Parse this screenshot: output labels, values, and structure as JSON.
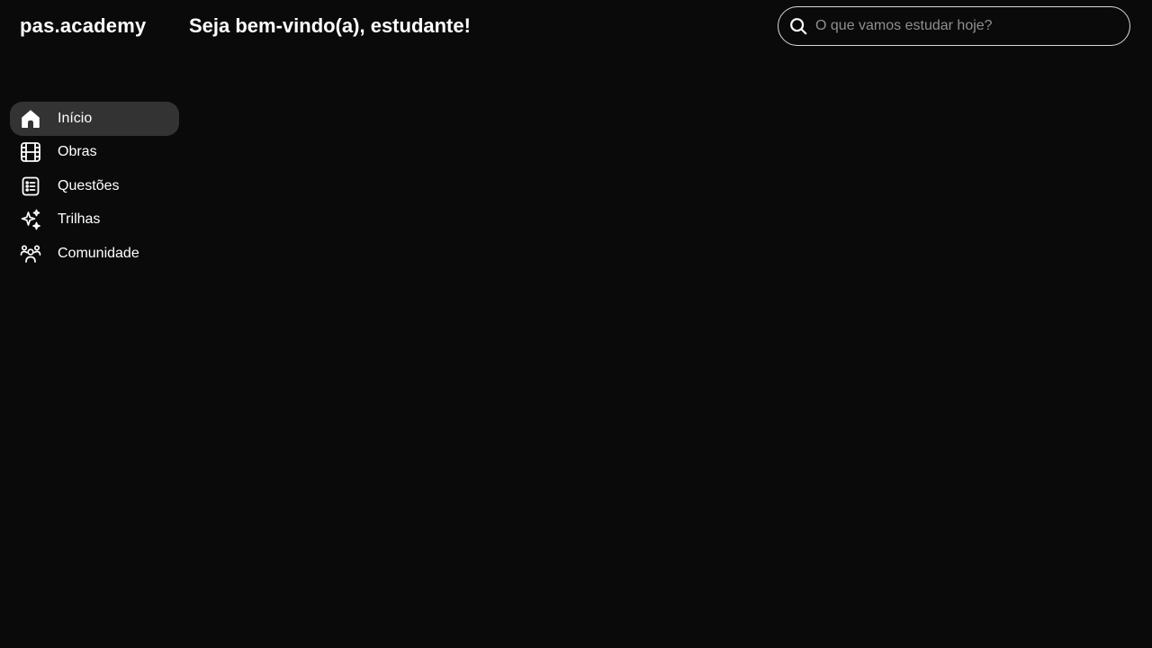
{
  "header": {
    "logo": "pas.academy",
    "welcome": "Seja bem-vindo(a), estudante!"
  },
  "search": {
    "icon": "search-icon",
    "placeholder": "O que vamos estudar hoje?",
    "value": ""
  },
  "sidebar": {
    "items": [
      {
        "label": "Início",
        "icon": "home-icon",
        "active": true
      },
      {
        "label": "Obras",
        "icon": "film-icon",
        "active": false
      },
      {
        "label": "Questões",
        "icon": "list-icon",
        "active": false
      },
      {
        "label": "Trilhas",
        "icon": "sparkles-icon",
        "active": false
      },
      {
        "label": "Comunidade",
        "icon": "users-icon",
        "active": false
      }
    ]
  },
  "colors": {
    "background": "#0a0a0a",
    "active_item": "#333333",
    "text": "#ffffff",
    "placeholder": "#8f8f8f",
    "search_border": "#d9d9d9"
  }
}
